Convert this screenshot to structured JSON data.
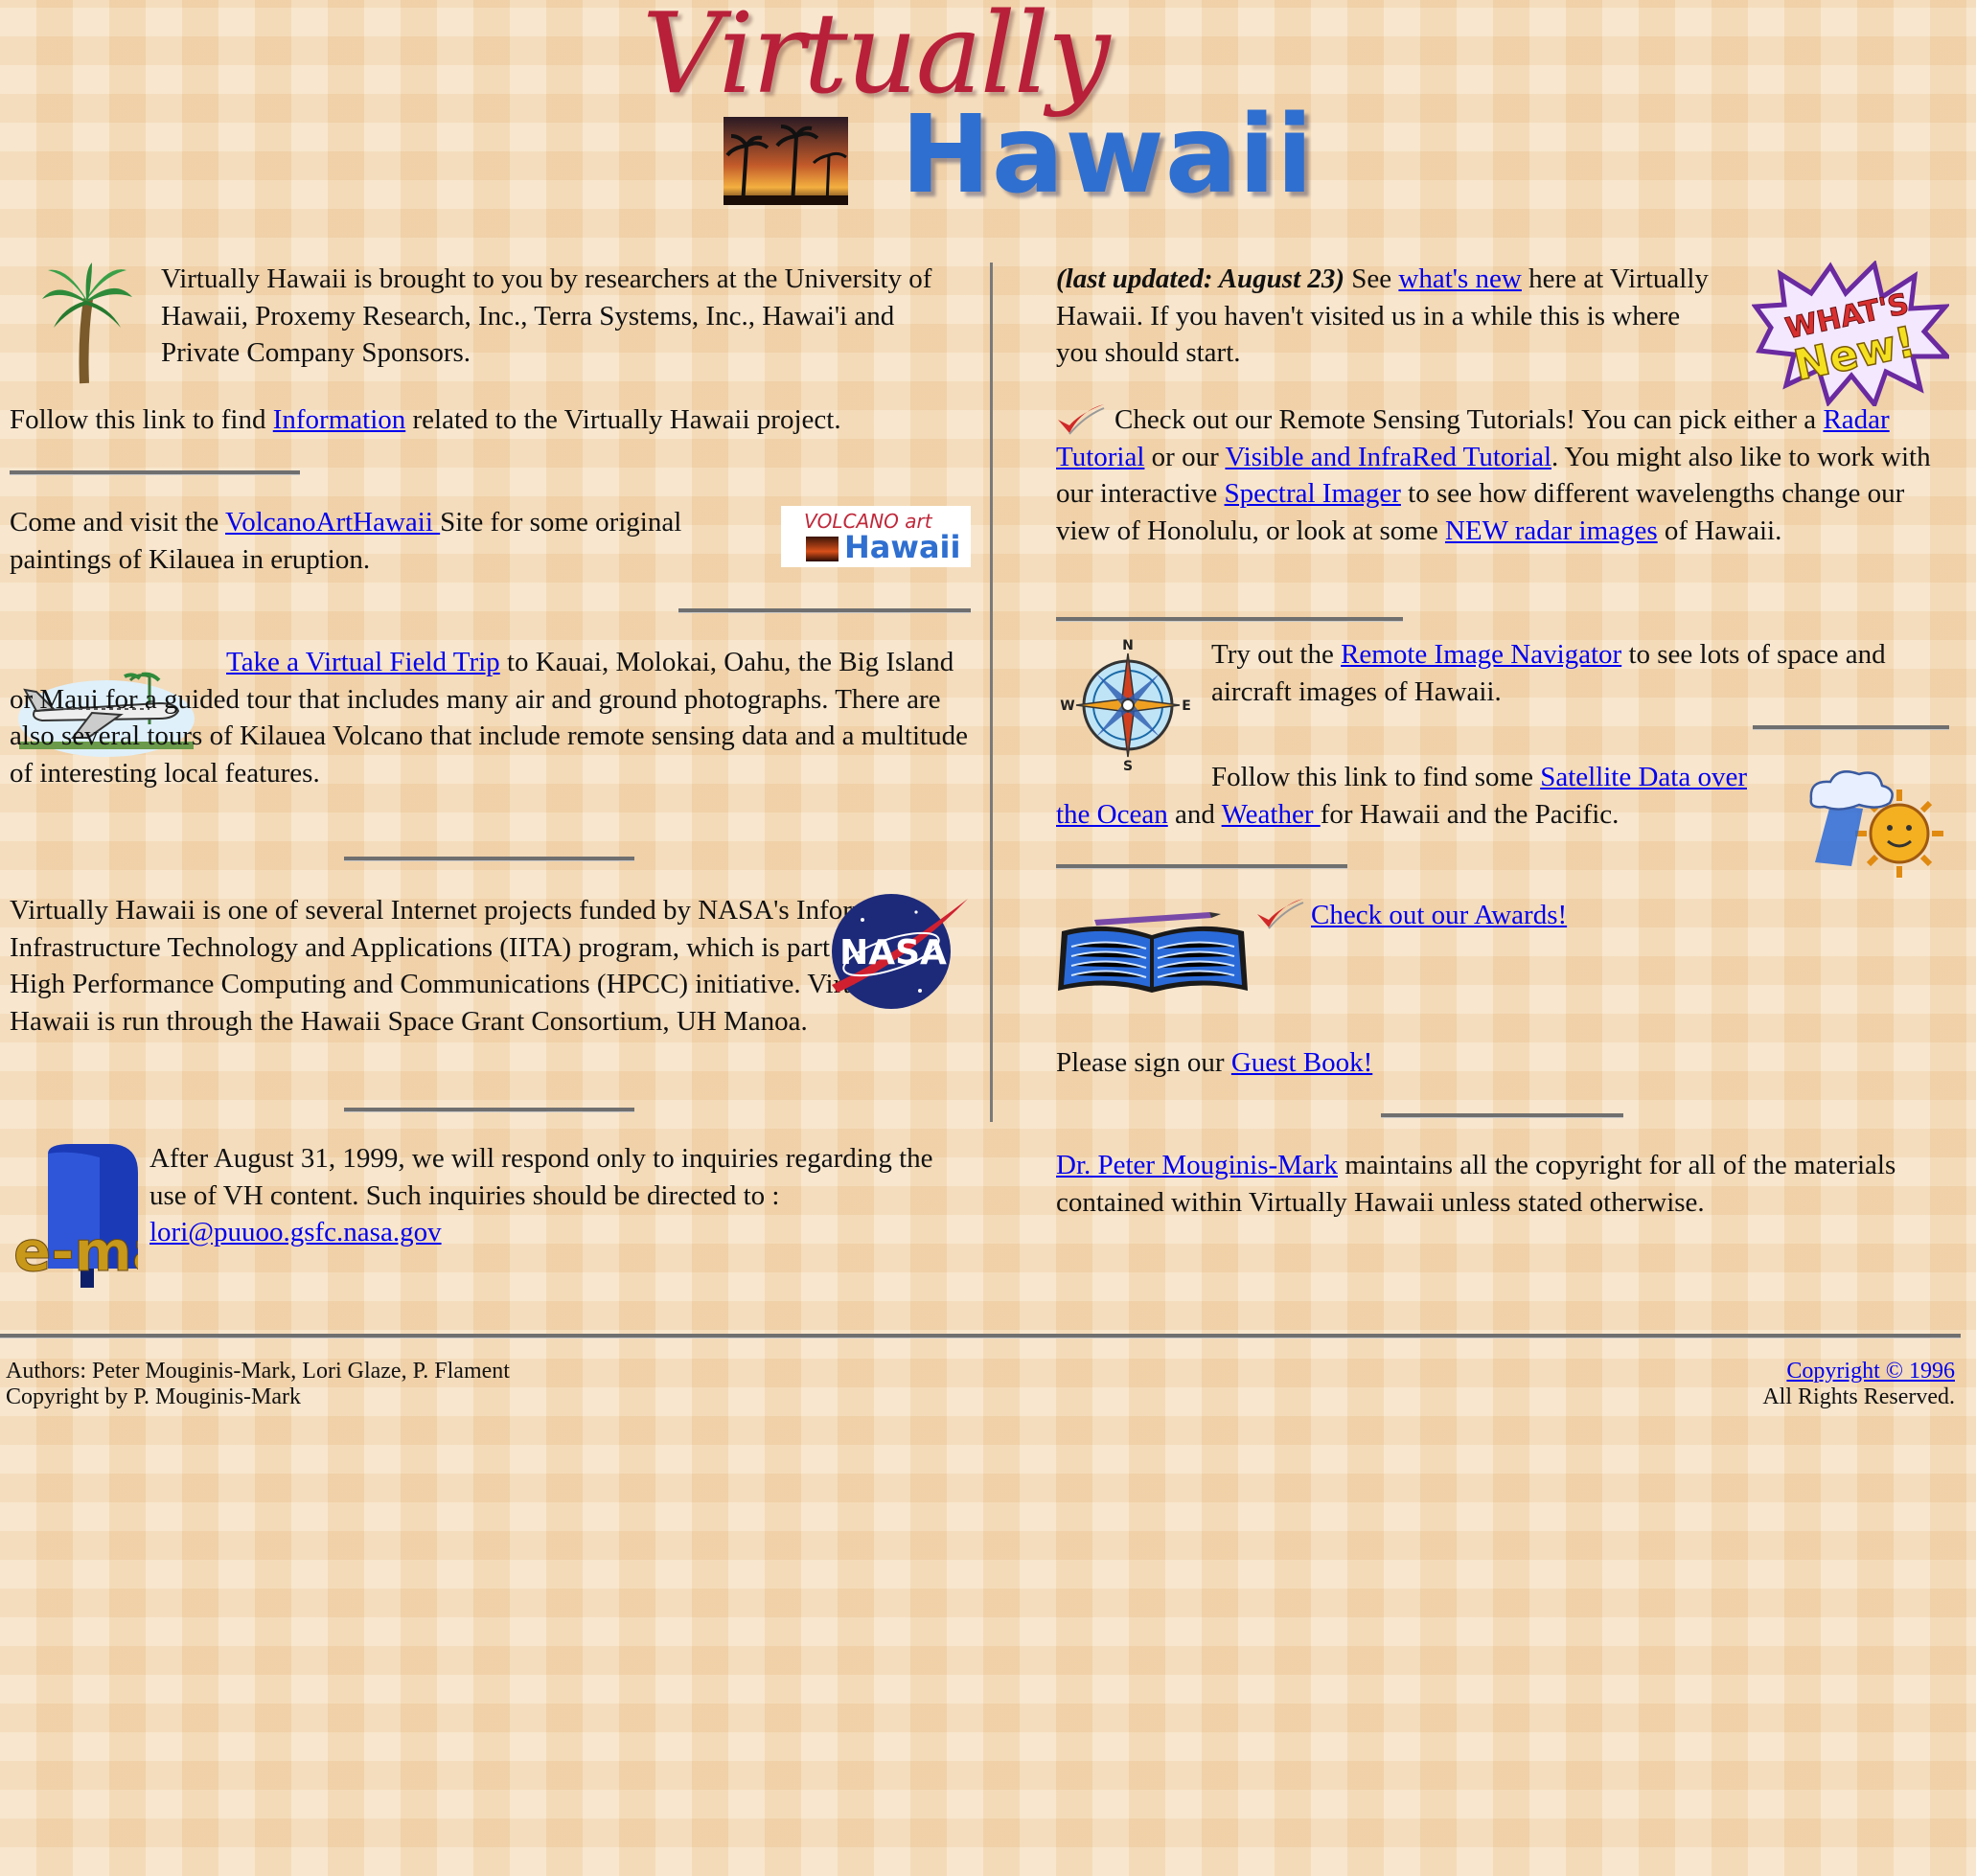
{
  "logo": {
    "word1": "Virtually",
    "word2": "Hawaii"
  },
  "left": {
    "intro": "Virtually Hawaii is brought to you by researchers at the University of Hawaii, Proxemy Research, Inc., Terra Systems, Inc., Hawai'i and Private Company Sponsors.",
    "info_pre": "Follow this link to find ",
    "info_link": "Information",
    "info_post": " related to the Virtually Hawaii project.",
    "volcano_pre": "Come and visit the ",
    "volcano_link": "VolcanoArtHawaii ",
    "volcano_post": "Site for some original paintings of Kilauea in eruption.",
    "volcano_logo_top": "VOLCANO art",
    "volcano_logo_bottom": "Hawaii",
    "trip_link": "Take a Virtual Field Trip",
    "trip_post": " to Kauai, Molokai, Oahu, the Big Island or Maui for a guided tour that includes many air and ground photographs. There are also several tours of Kilauea Volcano that include remote sensing data and a multitude of interesting local features.",
    "nasa_text": "Virtually Hawaii is one of several Internet projects funded by NASA's Information Infrastructure Technology and Applications (IITA) program, which is part of the High Performance Computing and Communications (HPCC) initiative. Virtually Hawaii is run through the Hawaii Space Grant Consortium, UH Manoa.",
    "nasa_logo": "NASA",
    "mail_text": "After August 31, 1999, we will respond only to inquiries regarding the use of VH content. Such inquiries should be directed to :",
    "mail_link": "lori@puuoo.gsfc.nasa.gov",
    "mail_icon_text": "e-mail"
  },
  "right": {
    "updated_bold": "(last updated: August 23)",
    "updated_pre": " See ",
    "whatsnew_link": "what's new",
    "updated_post": " here at Virtually Hawaii. If you haven't visited us in a while this is where you should start.",
    "whatsnew_badge1": "WHAT'S",
    "whatsnew_badge2": "New!",
    "rs_pre": "Check out our Remote Sensing Tutorials! You can pick either a ",
    "radar_link": "Radar Tutorial",
    "rs_mid1": " or our ",
    "visible_link": "Visible and InfraRed Tutorial",
    "rs_mid2": ". You might also like to work with our interactive ",
    "spectral_link": "Spectral Imager",
    "rs_mid3": " to see how different wavelengths change our view of Honolulu, or look at some ",
    "newradar_link": "NEW radar images",
    "rs_post": " of Hawaii.",
    "compass_letters": {
      "n": "N",
      "s": "S",
      "e": "E",
      "w": "W"
    },
    "nav_pre": "Try out the ",
    "nav_link": "Remote Image Navigator",
    "nav_post": " to see lots of space and aircraft images of Hawaii.",
    "sat_pre": "Follow this link to find some ",
    "sat_link": "Satellite Data over the Ocean",
    "sat_mid": " and ",
    "weather_link": "Weather ",
    "sat_post": "for Hawaii and the Pacific.",
    "awards_link": "Check out our Awards!",
    "guest_pre": "Please sign our ",
    "guest_link": "Guest Book!",
    "copyright_link": "Dr. Peter Mouginis-Mark",
    "copyright_post": " maintains all the copyright for all of the materials contained within Virtually Hawaii unless stated otherwise."
  },
  "footer": {
    "authors": "Authors: Peter Mouginis-Mark, Lori Glaze, P. Flament",
    "copyright_by": "Copyright by P. Mouginis-Mark",
    "copyright_link": "Copyright © 1996",
    "rights": "All Rights Reserved."
  },
  "colors": {
    "logo_red": "#b8203a",
    "logo_blue": "#2f6fd0",
    "link": "#0000ee",
    "rule": "#6f6f6f"
  }
}
